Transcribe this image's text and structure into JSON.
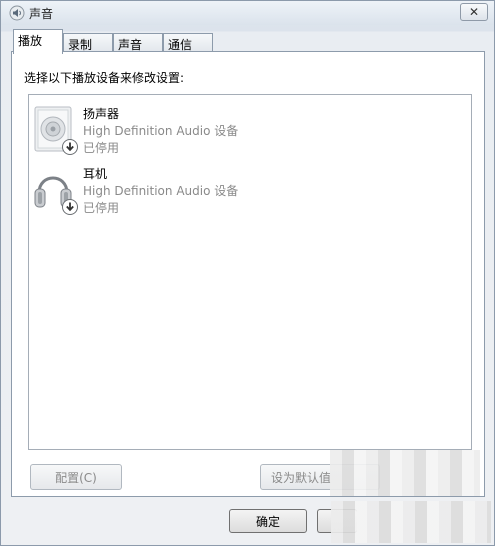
{
  "window": {
    "title": "声音",
    "close_label": "✕"
  },
  "tabs": [
    {
      "label": "播放",
      "active": true
    },
    {
      "label": "录制",
      "active": false
    },
    {
      "label": "声音",
      "active": false
    },
    {
      "label": "通信",
      "active": false
    }
  ],
  "panel": {
    "instruction": "选择以下播放设备来修改设置:"
  },
  "devices": [
    {
      "name": "扬声器",
      "description": "High Definition Audio 设备",
      "status": "已停用",
      "icon": "speaker-icon"
    },
    {
      "name": "耳机",
      "description": "High Definition Audio 设备",
      "status": "已停用",
      "icon": "headphones-icon"
    }
  ],
  "buttons": {
    "configure": "配置(C)",
    "set_default": "设为默认值",
    "ok": "确定"
  }
}
